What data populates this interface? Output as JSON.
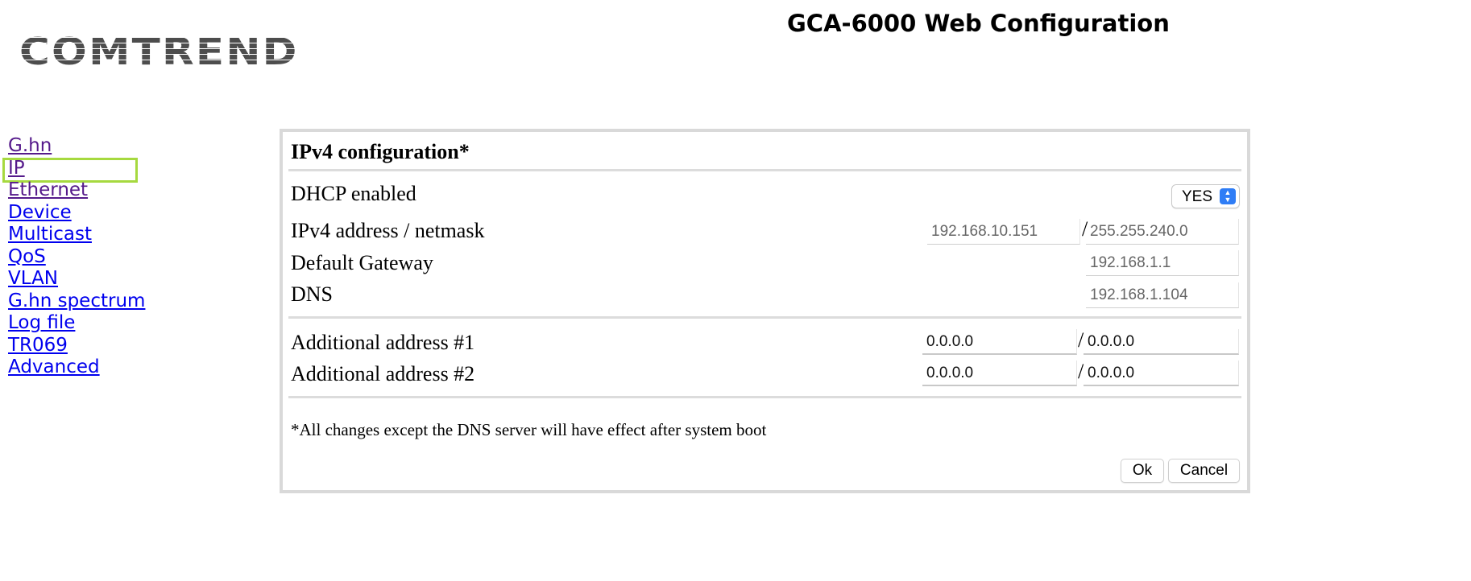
{
  "header": {
    "logo_text": "COMTREND",
    "app_title": "GCA-6000 Web Configuration"
  },
  "sidebar": {
    "items": [
      {
        "label": "G.hn"
      },
      {
        "label": "IP",
        "selected": true
      },
      {
        "label": "Ethernet"
      },
      {
        "label": "Device"
      },
      {
        "label": "Multicast"
      },
      {
        "label": "QoS"
      },
      {
        "label": "VLAN"
      },
      {
        "label": "G.hn spectrum"
      },
      {
        "label": "Log file"
      },
      {
        "label": "TR069"
      },
      {
        "label": "Advanced"
      }
    ],
    "highlight_color": "#a6d93f"
  },
  "panel": {
    "title": "IPv4 configuration*",
    "dhcp": {
      "label": "DHCP enabled",
      "value": "YES"
    },
    "ipv4": {
      "label": "IPv4 address / netmask",
      "address": "192.168.10.151",
      "separator": "/",
      "netmask": "255.255.240.0"
    },
    "gateway": {
      "label": "Default Gateway",
      "value": "192.168.1.1"
    },
    "dns": {
      "label": "DNS",
      "value": "192.168.1.104"
    },
    "additional": [
      {
        "label": "Additional address #1",
        "address": "0.0.0.0",
        "separator": "/",
        "netmask": "0.0.0.0"
      },
      {
        "label": "Additional address #2",
        "address": "0.0.0.0",
        "separator": "/",
        "netmask": "0.0.0.0"
      }
    ],
    "note": "*All changes except the DNS server will have effect after system boot",
    "ok_label": "Ok",
    "cancel_label": "Cancel"
  }
}
